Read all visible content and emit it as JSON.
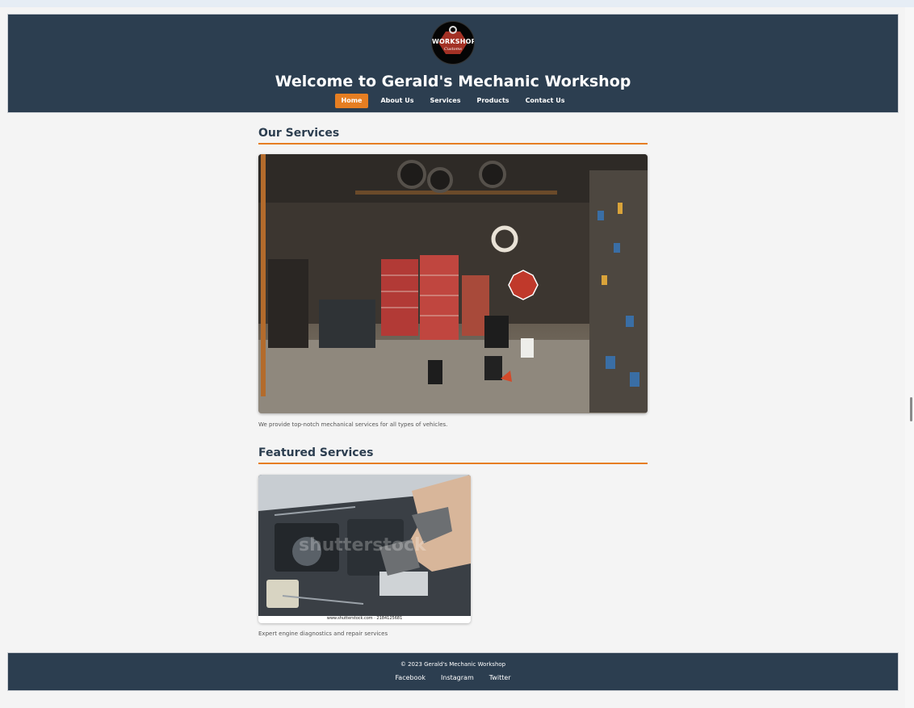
{
  "header": {
    "logo_text": "WORKSHOP",
    "logo_subtext": "Customs",
    "title": "Welcome to Gerald's Mechanic Workshop",
    "nav": [
      {
        "label": "Home",
        "active": true
      },
      {
        "label": "About Us",
        "active": false
      },
      {
        "label": "Services",
        "active": false
      },
      {
        "label": "Products",
        "active": false
      },
      {
        "label": "Contact Us",
        "active": false
      }
    ]
  },
  "main": {
    "services_heading": "Our Services",
    "services_image_icon": "garage-photo",
    "services_description": "We provide top-notch mechanical services for all types of vehicles.",
    "featured_heading": "Featured Services",
    "featured_card": {
      "image_icon": "engine-repair-photo",
      "image_caption": "www.shutterstock.com · 2184125681",
      "watermark": "shutterstock",
      "description": "Expert engine diagnostics and repair services"
    }
  },
  "footer": {
    "copyright": "© 2023 Gerald's Mechanic Workshop",
    "social": [
      {
        "label": "Facebook"
      },
      {
        "label": "Instagram"
      },
      {
        "label": "Twitter"
      }
    ]
  },
  "colors": {
    "header_bg": "#2c3e50",
    "accent": "#e67e22",
    "page_bg": "#f4f4f4"
  }
}
